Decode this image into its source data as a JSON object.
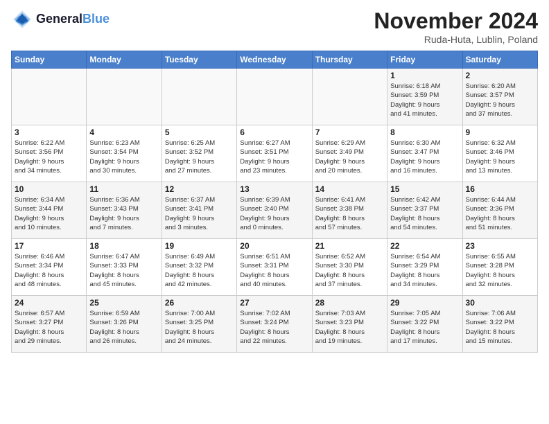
{
  "header": {
    "logo_line1": "General",
    "logo_line2": "Blue",
    "month": "November 2024",
    "location": "Ruda-Huta, Lublin, Poland"
  },
  "weekdays": [
    "Sunday",
    "Monday",
    "Tuesday",
    "Wednesday",
    "Thursday",
    "Friday",
    "Saturday"
  ],
  "weeks": [
    [
      {
        "day": "",
        "info": ""
      },
      {
        "day": "",
        "info": ""
      },
      {
        "day": "",
        "info": ""
      },
      {
        "day": "",
        "info": ""
      },
      {
        "day": "",
        "info": ""
      },
      {
        "day": "1",
        "info": "Sunrise: 6:18 AM\nSunset: 3:59 PM\nDaylight: 9 hours\nand 41 minutes."
      },
      {
        "day": "2",
        "info": "Sunrise: 6:20 AM\nSunset: 3:57 PM\nDaylight: 9 hours\nand 37 minutes."
      }
    ],
    [
      {
        "day": "3",
        "info": "Sunrise: 6:22 AM\nSunset: 3:56 PM\nDaylight: 9 hours\nand 34 minutes."
      },
      {
        "day": "4",
        "info": "Sunrise: 6:23 AM\nSunset: 3:54 PM\nDaylight: 9 hours\nand 30 minutes."
      },
      {
        "day": "5",
        "info": "Sunrise: 6:25 AM\nSunset: 3:52 PM\nDaylight: 9 hours\nand 27 minutes."
      },
      {
        "day": "6",
        "info": "Sunrise: 6:27 AM\nSunset: 3:51 PM\nDaylight: 9 hours\nand 23 minutes."
      },
      {
        "day": "7",
        "info": "Sunrise: 6:29 AM\nSunset: 3:49 PM\nDaylight: 9 hours\nand 20 minutes."
      },
      {
        "day": "8",
        "info": "Sunrise: 6:30 AM\nSunset: 3:47 PM\nDaylight: 9 hours\nand 16 minutes."
      },
      {
        "day": "9",
        "info": "Sunrise: 6:32 AM\nSunset: 3:46 PM\nDaylight: 9 hours\nand 13 minutes."
      }
    ],
    [
      {
        "day": "10",
        "info": "Sunrise: 6:34 AM\nSunset: 3:44 PM\nDaylight: 9 hours\nand 10 minutes."
      },
      {
        "day": "11",
        "info": "Sunrise: 6:36 AM\nSunset: 3:43 PM\nDaylight: 9 hours\nand 7 minutes."
      },
      {
        "day": "12",
        "info": "Sunrise: 6:37 AM\nSunset: 3:41 PM\nDaylight: 9 hours\nand 3 minutes."
      },
      {
        "day": "13",
        "info": "Sunrise: 6:39 AM\nSunset: 3:40 PM\nDaylight: 9 hours\nand 0 minutes."
      },
      {
        "day": "14",
        "info": "Sunrise: 6:41 AM\nSunset: 3:38 PM\nDaylight: 8 hours\nand 57 minutes."
      },
      {
        "day": "15",
        "info": "Sunrise: 6:42 AM\nSunset: 3:37 PM\nDaylight: 8 hours\nand 54 minutes."
      },
      {
        "day": "16",
        "info": "Sunrise: 6:44 AM\nSunset: 3:36 PM\nDaylight: 8 hours\nand 51 minutes."
      }
    ],
    [
      {
        "day": "17",
        "info": "Sunrise: 6:46 AM\nSunset: 3:34 PM\nDaylight: 8 hours\nand 48 minutes."
      },
      {
        "day": "18",
        "info": "Sunrise: 6:47 AM\nSunset: 3:33 PM\nDaylight: 8 hours\nand 45 minutes."
      },
      {
        "day": "19",
        "info": "Sunrise: 6:49 AM\nSunset: 3:32 PM\nDaylight: 8 hours\nand 42 minutes."
      },
      {
        "day": "20",
        "info": "Sunrise: 6:51 AM\nSunset: 3:31 PM\nDaylight: 8 hours\nand 40 minutes."
      },
      {
        "day": "21",
        "info": "Sunrise: 6:52 AM\nSunset: 3:30 PM\nDaylight: 8 hours\nand 37 minutes."
      },
      {
        "day": "22",
        "info": "Sunrise: 6:54 AM\nSunset: 3:29 PM\nDaylight: 8 hours\nand 34 minutes."
      },
      {
        "day": "23",
        "info": "Sunrise: 6:55 AM\nSunset: 3:28 PM\nDaylight: 8 hours\nand 32 minutes."
      }
    ],
    [
      {
        "day": "24",
        "info": "Sunrise: 6:57 AM\nSunset: 3:27 PM\nDaylight: 8 hours\nand 29 minutes."
      },
      {
        "day": "25",
        "info": "Sunrise: 6:59 AM\nSunset: 3:26 PM\nDaylight: 8 hours\nand 26 minutes."
      },
      {
        "day": "26",
        "info": "Sunrise: 7:00 AM\nSunset: 3:25 PM\nDaylight: 8 hours\nand 24 minutes."
      },
      {
        "day": "27",
        "info": "Sunrise: 7:02 AM\nSunset: 3:24 PM\nDaylight: 8 hours\nand 22 minutes."
      },
      {
        "day": "28",
        "info": "Sunrise: 7:03 AM\nSunset: 3:23 PM\nDaylight: 8 hours\nand 19 minutes."
      },
      {
        "day": "29",
        "info": "Sunrise: 7:05 AM\nSunset: 3:22 PM\nDaylight: 8 hours\nand 17 minutes."
      },
      {
        "day": "30",
        "info": "Sunrise: 7:06 AM\nSunset: 3:22 PM\nDaylight: 8 hours\nand 15 minutes."
      }
    ]
  ]
}
